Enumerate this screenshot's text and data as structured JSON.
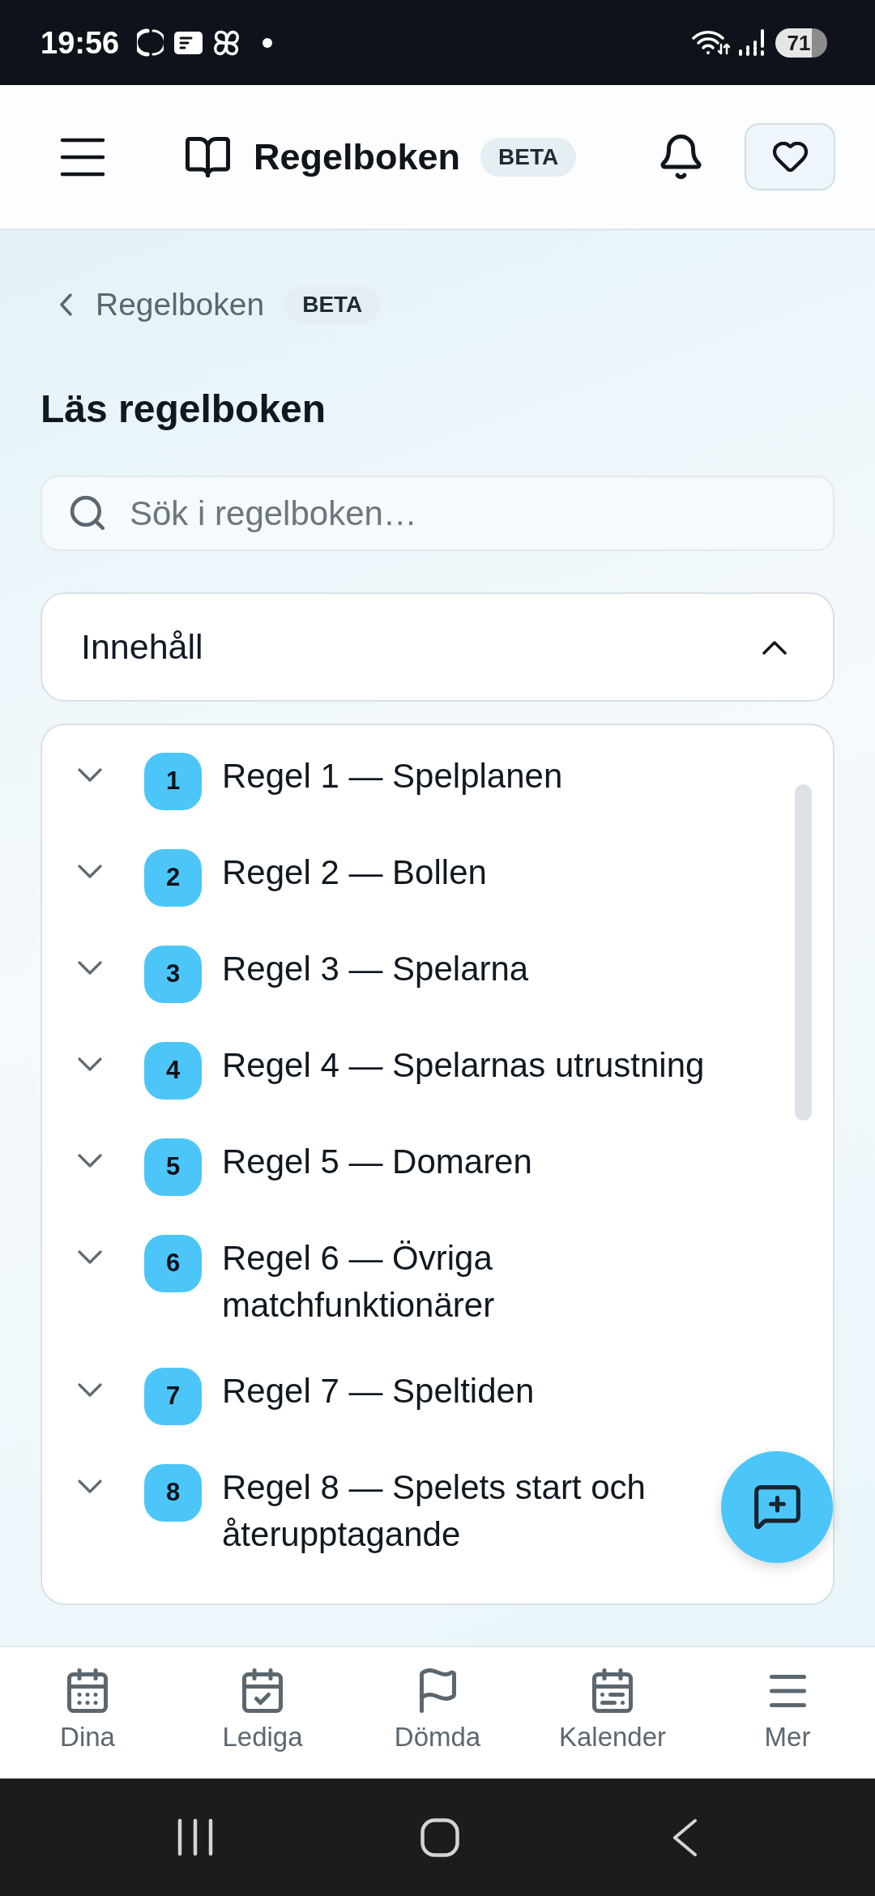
{
  "status_bar": {
    "time": "19:56",
    "battery": "71"
  },
  "header": {
    "title": "Regelboken",
    "badge": "BETA"
  },
  "breadcrumb": {
    "back_label": "Regelboken",
    "badge": "BETA"
  },
  "page_title": "Läs regelboken",
  "search": {
    "placeholder": "Sök i regelboken…"
  },
  "contents": {
    "title": "Innehåll",
    "expanded": true
  },
  "rules": [
    {
      "number": "1",
      "title": "Regel 1 — Spelplanen",
      "expanded": false
    },
    {
      "number": "2",
      "title": "Regel 2 — Bollen",
      "expanded": false
    },
    {
      "number": "3",
      "title": "Regel 3 — Spelarna",
      "expanded": false
    },
    {
      "number": "4",
      "title": "Regel 4 — Spelarnas utrustning",
      "expanded": false
    },
    {
      "number": "5",
      "title": "Regel 5 — Domaren",
      "expanded": false
    },
    {
      "number": "6",
      "title": "Regel 6 — Övriga matchfunktionärer",
      "expanded": false
    },
    {
      "number": "7",
      "title": "Regel 7 — Speltiden",
      "expanded": false
    },
    {
      "number": "8",
      "title": "Regel 8 — Spelets start och återupptagande",
      "expanded": false
    }
  ],
  "bottom_nav": [
    {
      "label": "Dina",
      "selected": false
    },
    {
      "label": "Lediga",
      "selected": false
    },
    {
      "label": "Dömda",
      "selected": false
    },
    {
      "label": "Kalender",
      "selected": false
    },
    {
      "label": "Mer",
      "selected": false
    }
  ]
}
